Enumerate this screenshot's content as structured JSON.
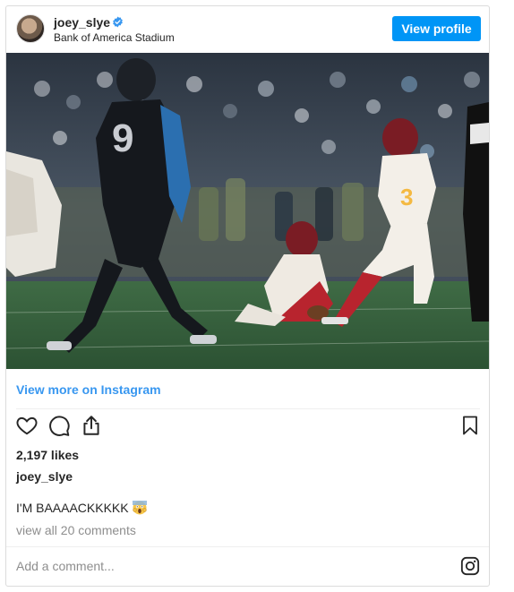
{
  "post": {
    "username": "joey_slye",
    "location": "Bank of America Stadium",
    "view_profile_label": "View profile",
    "photo_icon": "football-field-goal-photo",
    "view_more_label": "View more on Instagram",
    "likes": "2,197 likes",
    "owner": "joey_slye",
    "caption": "I'M BAAAACKKKKK",
    "caption_emoji": "scream-emoji",
    "comments_link": "view all 20 comments",
    "comment_placeholder": "Add a comment..."
  },
  "icons": {
    "like": "heart-icon",
    "comment": "comment-icon",
    "share": "share-icon",
    "save": "bookmark-icon",
    "verified": "verified-badge-icon",
    "instagram": "instagram-icon"
  },
  "colors": {
    "accent": "#0095f6",
    "link": "#3897f0",
    "muted": "#8e8e8e"
  }
}
